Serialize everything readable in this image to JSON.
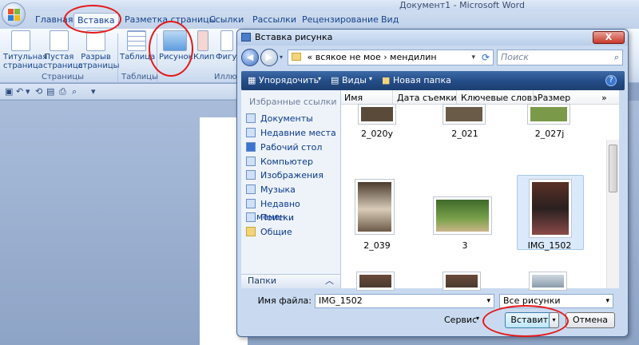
{
  "window": {
    "title": "Документ1 - Microsoft Word"
  },
  "ribbon_tabs": [
    "Главная",
    "Вставка",
    "Разметка страницы",
    "Ссылки",
    "Рассылки",
    "Рецензирование",
    "Вид"
  ],
  "ribbon": {
    "title_page": "Титульная\nстраница",
    "blank_page": "Пустая\nстраница",
    "page_break": "Разрыв\nстраницы",
    "table": "Таблица",
    "picture": "Рисунок",
    "clip": "Клип",
    "shapes": "Фигур",
    "group_pages": "Страницы",
    "group_tables": "Таблицы",
    "group_illustrations": "Иллю"
  },
  "dialog": {
    "title": "Вставка рисунка",
    "close": "X",
    "address": "«  всякое не мое  ›  мендилин",
    "search_placeholder": "Поиск",
    "toolbar": {
      "organize": "Упорядочить",
      "views": "Виды",
      "new_folder": "Новая папка"
    },
    "nav_header": "Избранные ссылки",
    "nav_items": [
      "Документы",
      "Недавние места",
      "Рабочий стол",
      "Компьютер",
      "Изображения",
      "Музыка",
      "Недавно изменен...",
      "Поиски",
      "Общие"
    ],
    "folders": "Папки",
    "columns": [
      "Имя",
      "Дата съемки",
      "Ключевые слова",
      "Размер",
      "»"
    ],
    "files": [
      "2_020y",
      "2_021",
      "2_027j",
      "2_039",
      "3",
      "IMG_1502"
    ],
    "filename_label": "Имя файла:",
    "filename_value": "IMG_1502",
    "filetype_value": "Все рисунки",
    "service": "Сервис",
    "insert_button": "Вставить",
    "cancel_button": "Отмена"
  }
}
